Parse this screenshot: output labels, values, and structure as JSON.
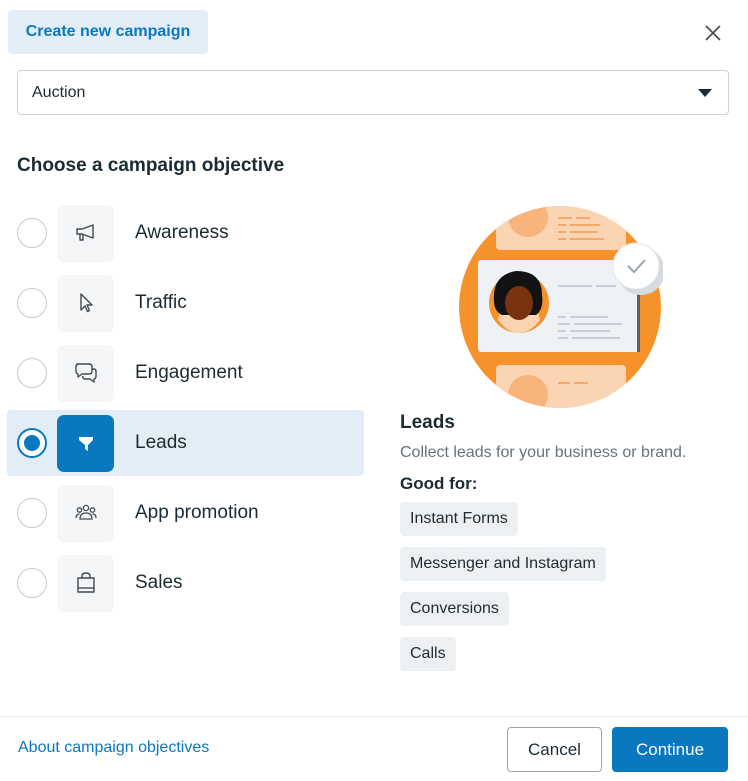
{
  "header": {
    "tab_label": "Create new campaign",
    "close_icon": "close-icon"
  },
  "buying_type": {
    "selected": "Auction"
  },
  "section_title": "Choose a campaign objective",
  "objectives": [
    {
      "label": "Awareness",
      "icon": "megaphone-icon",
      "selected": false
    },
    {
      "label": "Traffic",
      "icon": "cursor-icon",
      "selected": false
    },
    {
      "label": "Engagement",
      "icon": "chat-bubbles-icon",
      "selected": false
    },
    {
      "label": "Leads",
      "icon": "funnel-icon",
      "selected": true
    },
    {
      "label": "App promotion",
      "icon": "people-group-icon",
      "selected": false
    },
    {
      "label": "Sales",
      "icon": "shopping-bag-icon",
      "selected": false
    }
  ],
  "detail": {
    "title": "Leads",
    "description": "Collect leads for your business or brand.",
    "good_for_label": "Good for:",
    "good_for": [
      "Instant Forms",
      "Messenger and Instagram",
      "Conversions",
      "Calls"
    ]
  },
  "footer": {
    "about_link": "About campaign objectives",
    "cancel_label": "Cancel",
    "continue_label": "Continue"
  },
  "colors": {
    "accent": "#0a78be",
    "selected_bg": "#e2edf7",
    "illustration_orange": "#f5922a"
  }
}
